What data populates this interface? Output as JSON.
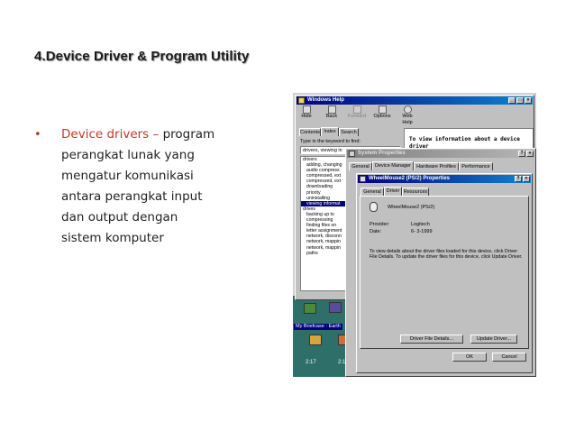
{
  "slide": {
    "title": "4.Device Driver & Program Utility",
    "bullet_lead": "Device drivers",
    "bullet_dash": " – ",
    "bullet_first": "program",
    "bullet_lines": [
      "perangkat lunak yang",
      "mengatur komunikasi",
      "antara perangkat input",
      "dan output dengan",
      "sistem komputer"
    ]
  },
  "help_window": {
    "title": "Windows Help",
    "toolbar": [
      "Hide",
      "Back",
      "Forward",
      "Options",
      "Web Help"
    ],
    "tabs": [
      "Contents",
      "Index",
      "Search"
    ],
    "prompt": "Type in the keyword to find:",
    "keyword": "drivers, viewing in",
    "list": [
      {
        "text": "drivers",
        "sub": false,
        "sel": false
      },
      {
        "text": "adding, changing",
        "sub": true,
        "sel": false
      },
      {
        "text": "audio compress",
        "sub": true,
        "sel": false
      },
      {
        "text": "compressed, ext",
        "sub": true,
        "sel": false
      },
      {
        "text": "compressed, ext",
        "sub": true,
        "sel": false
      },
      {
        "text": "downloading",
        "sub": true,
        "sel": false
      },
      {
        "text": "priority",
        "sub": true,
        "sel": false
      },
      {
        "text": "uninstalling",
        "sub": true,
        "sel": false
      },
      {
        "text": "viewing informat",
        "sub": true,
        "sel": true
      },
      {
        "text": "drives",
        "sub": false,
        "sel": false
      },
      {
        "text": "backing up to",
        "sub": true,
        "sel": false
      },
      {
        "text": "compressing",
        "sub": true,
        "sel": false
      },
      {
        "text": "finding files on",
        "sub": true,
        "sel": false
      },
      {
        "text": "letter assignment",
        "sub": true,
        "sel": false
      },
      {
        "text": "network, disconn",
        "sub": true,
        "sel": false
      },
      {
        "text": "network, mappin",
        "sub": true,
        "sel": false
      },
      {
        "text": "network, mappin",
        "sub": true,
        "sel": false
      },
      {
        "text": "paths",
        "sub": true,
        "sel": false
      }
    ],
    "topic_line1": "To view information about a device",
    "topic_line2": "driver"
  },
  "system_properties": {
    "title": "System Properties",
    "tabs": [
      "General",
      "Device Manager",
      "Hardware Profiles",
      "Performance"
    ]
  },
  "device_dialog": {
    "title": "WheelMouse2 (PS/2) Properties",
    "tabs": [
      "General",
      "Driver",
      "Resources"
    ],
    "device_name": "WheelMouse2 (PS/2)",
    "provider_label": "Provider:",
    "provider_value": "Logitech",
    "date_label": "Date:",
    "date_value": "6- 3-1999",
    "info_text": "To view details about the driver files loaded for this device, click Driver File Details. To update the driver files for this device, click Update Driver.",
    "details_button": "Driver File Details...",
    "update_button": "Update Driver...",
    "ok_button": "OK",
    "cancel_button": "Cancel"
  },
  "desktop": {
    "icon_label": "My Briefcase",
    "icon_label2": "Earth",
    "clock1": "2:17",
    "clock2": "2:17"
  }
}
